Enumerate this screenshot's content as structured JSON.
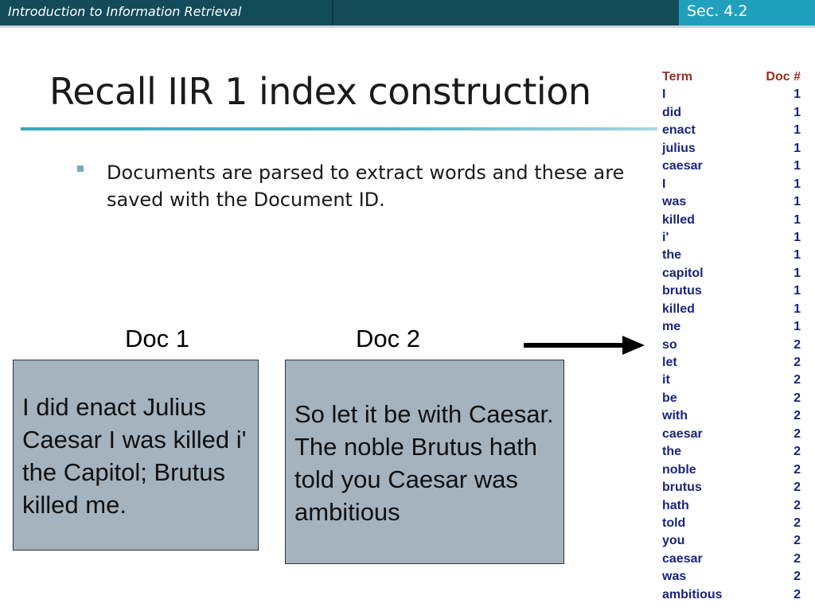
{
  "header": {
    "course_title": "Introduction to Information Retrieval",
    "section": "Sec. 4.2"
  },
  "slide": {
    "title": "Recall IIR 1 index construction",
    "bullet": "Documents are parsed to extract words and these are saved with the Document ID."
  },
  "documents": [
    {
      "label": "Doc 1",
      "text": "I did enact Julius Caesar I was killed i' the Capitol; Brutus killed me."
    },
    {
      "label": "Doc 2",
      "text": "So let it be with Caesar. The noble Brutus hath told you Caesar was ambitious"
    }
  ],
  "colors": {
    "header_bg": "#124b5a",
    "section_bg": "#21a0bd",
    "doc_box_bg": "#a5b3be",
    "table_header": "#9a2d1f",
    "table_text": "#1a237e"
  },
  "icons": {
    "arrow": "right-arrow-icon",
    "bullet": "square-bullet-icon"
  },
  "term_table": {
    "headers": {
      "term": "Term",
      "doc": "Doc #"
    },
    "rows": [
      {
        "term": "I",
        "doc": "1"
      },
      {
        "term": "did",
        "doc": "1"
      },
      {
        "term": "enact",
        "doc": "1"
      },
      {
        "term": "julius",
        "doc": "1"
      },
      {
        "term": "caesar",
        "doc": "1"
      },
      {
        "term": "I",
        "doc": "1"
      },
      {
        "term": "was",
        "doc": "1"
      },
      {
        "term": "killed",
        "doc": "1"
      },
      {
        "term": "i'",
        "doc": "1"
      },
      {
        "term": "the",
        "doc": "1"
      },
      {
        "term": "capitol",
        "doc": "1"
      },
      {
        "term": "brutus",
        "doc": "1"
      },
      {
        "term": "killed",
        "doc": "1"
      },
      {
        "term": "me",
        "doc": "1"
      },
      {
        "term": "so",
        "doc": "2"
      },
      {
        "term": "let",
        "doc": "2"
      },
      {
        "term": "it",
        "doc": "2"
      },
      {
        "term": "be",
        "doc": "2"
      },
      {
        "term": "with",
        "doc": "2"
      },
      {
        "term": "caesar",
        "doc": "2"
      },
      {
        "term": "the",
        "doc": "2"
      },
      {
        "term": "noble",
        "doc": "2"
      },
      {
        "term": "brutus",
        "doc": "2"
      },
      {
        "term": "hath",
        "doc": "2"
      },
      {
        "term": "told",
        "doc": "2"
      },
      {
        "term": "you",
        "doc": "2"
      },
      {
        "term": "caesar",
        "doc": "2"
      },
      {
        "term": "was",
        "doc": "2"
      },
      {
        "term": "ambitious",
        "doc": "2"
      }
    ]
  }
}
